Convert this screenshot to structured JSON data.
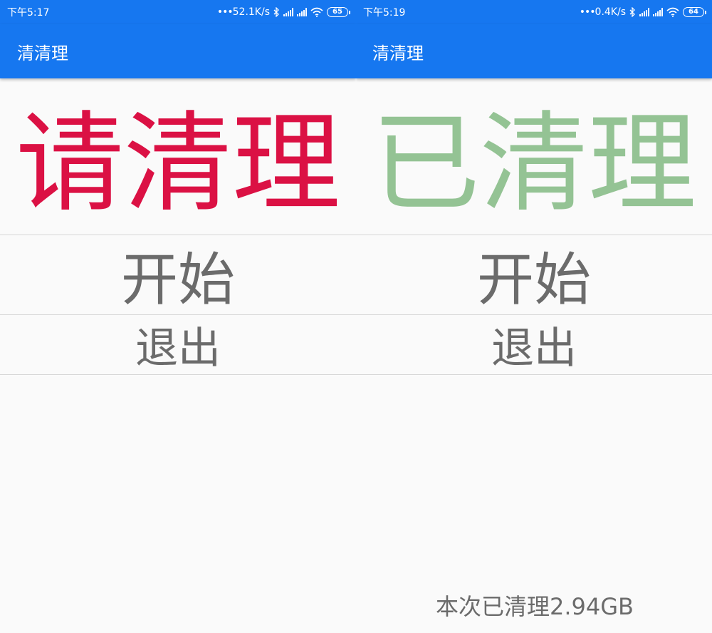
{
  "screens": [
    {
      "status_bar": {
        "time": "下午5:17",
        "dots": "•••",
        "net_speed": "52.1K/s",
        "battery": "65"
      },
      "app_bar": {
        "title": "清清理"
      },
      "headline": {
        "text": "请清理",
        "color": "#db1144"
      },
      "buttons": {
        "start": "开始",
        "exit": "退出"
      },
      "footer": {
        "cleaned_text": ""
      }
    },
    {
      "status_bar": {
        "time": "下午5:19",
        "dots": "•••",
        "net_speed": "0.4K/s",
        "battery": "64"
      },
      "app_bar": {
        "title": "清清理"
      },
      "headline": {
        "text": "已清理",
        "color": "#94c394"
      },
      "buttons": {
        "start": "开始",
        "exit": "退出"
      },
      "footer": {
        "cleaned_text": "本次已清理2.94GB"
      }
    }
  ],
  "colors": {
    "primary": "#1677f0",
    "status_text": "#ffffff",
    "button_text": "#6b6b6b",
    "divider": "#d6d6d6",
    "background": "#fafafa"
  },
  "icons": [
    "bluetooth-icon",
    "signal-icon",
    "wifi-icon",
    "battery-icon"
  ]
}
